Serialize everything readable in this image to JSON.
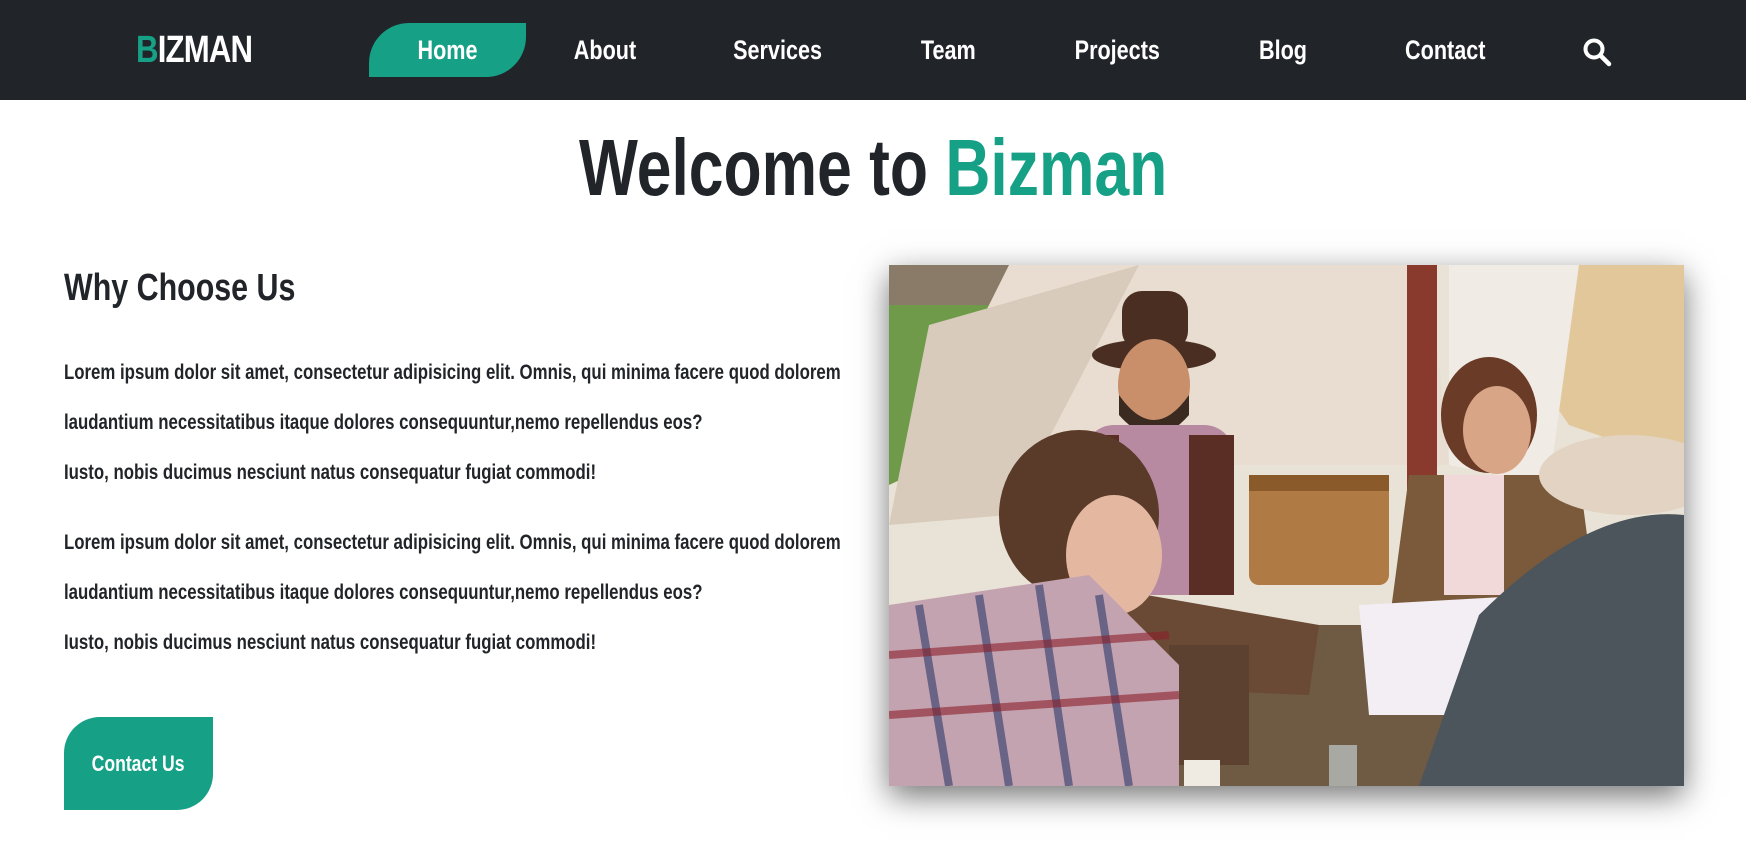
{
  "nav": {
    "logo_first": "B",
    "logo_rest": "IZMAN",
    "items": [
      {
        "label": "Home",
        "active": true
      },
      {
        "label": "About"
      },
      {
        "label": "Services"
      },
      {
        "label": "Team"
      },
      {
        "label": "Projects"
      },
      {
        "label": "Blog"
      },
      {
        "label": "Contact"
      }
    ],
    "search_icon": "search-icon"
  },
  "hero": {
    "title_prefix": "Welcome to ",
    "title_brand": "Bizman"
  },
  "why": {
    "heading": "Why Choose Us",
    "paragraphs": [
      {
        "line1": "Lorem ipsum dolor sit amet, consectetur adipisicing elit. Omnis, qui minima facere quod dolorem",
        "line2": "laudantium necessitatibus itaque dolores consequuntur,nemo repellendus eos?",
        "line3": "Iusto, nobis ducimus nesciunt natus consequatur fugiat commodi!"
      },
      {
        "line1": "Lorem ipsum dolor sit amet, consectetur adipisicing elit. Omnis, qui minima facere quod dolorem",
        "line2": "laudantium necessitatibus itaque dolores consequuntur,nemo repellendus eos?",
        "line3": "Iusto, nobis ducimus nesciunt natus consequatur fugiat commodi!"
      }
    ],
    "button_label": "Contact Us"
  },
  "colors": {
    "accent": "#16a085",
    "nav_bg": "#212529",
    "text": "#212529"
  }
}
